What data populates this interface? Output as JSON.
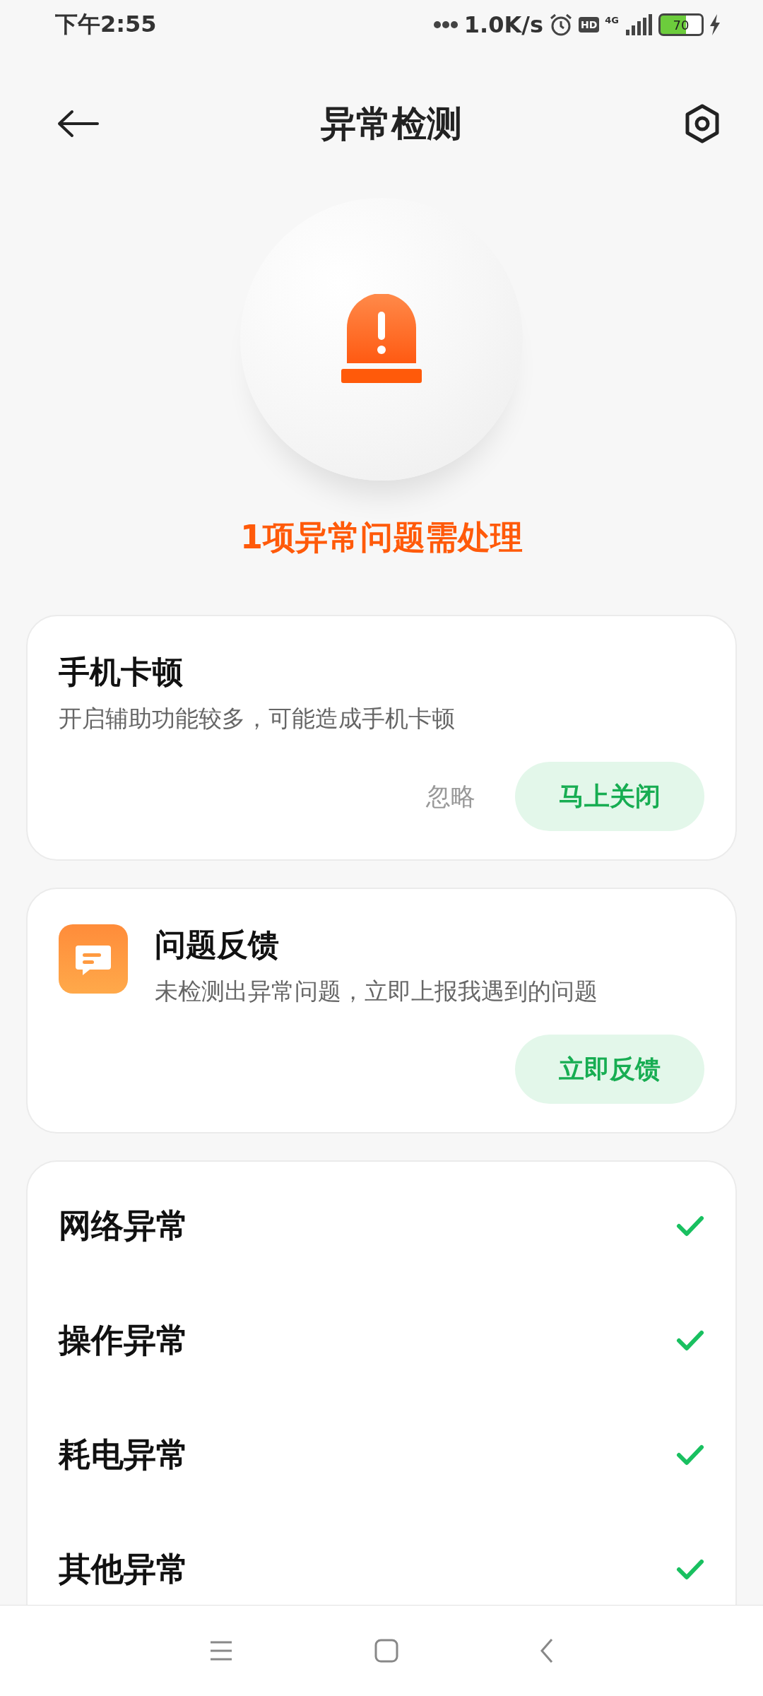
{
  "status_bar": {
    "time": "下午2:55",
    "speed": "1.0K/s",
    "hd": "HD",
    "network": "4G",
    "battery": "70"
  },
  "header": {
    "title": "异常检测"
  },
  "summary": {
    "text": "1项异常问题需处理"
  },
  "issue_card": {
    "title": "手机卡顿",
    "description": "开启辅助功能较多，可能造成手机卡顿",
    "secondary_button": "忽略",
    "primary_button": "马上关闭"
  },
  "feedback_card": {
    "title": "问题反馈",
    "description": "未检测出异常问题，立即上报我遇到的问题",
    "button": "立即反馈"
  },
  "checks": [
    {
      "label": "网络异常",
      "checked": true
    },
    {
      "label": "操作异常",
      "checked": true
    },
    {
      "label": "耗电异常",
      "checked": true
    },
    {
      "label": "其他异常",
      "checked": true
    }
  ]
}
